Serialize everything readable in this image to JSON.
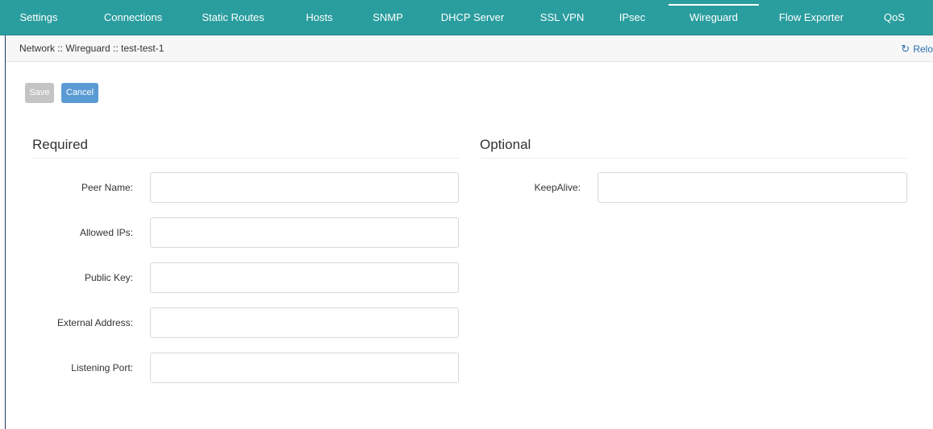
{
  "tabs": [
    {
      "label": "Settings"
    },
    {
      "label": "Connections"
    },
    {
      "label": "Static Routes"
    },
    {
      "label": "Hosts"
    },
    {
      "label": "SNMP"
    },
    {
      "label": "DHCP Server"
    },
    {
      "label": "SSL VPN"
    },
    {
      "label": "IPsec"
    },
    {
      "label": "Wireguard",
      "active": true
    },
    {
      "label": "Flow Exporter"
    },
    {
      "label": "QoS"
    }
  ],
  "breadcrumb": "Network :: Wireguard :: test-test-1",
  "reload_label": "Relo",
  "reload_icon": "refresh-icon",
  "buttons": {
    "save": "Save",
    "cancel": "Cancel"
  },
  "required": {
    "title": "Required",
    "fields": [
      {
        "label": "Peer Name:",
        "value": ""
      },
      {
        "label": "Allowed IPs:",
        "value": ""
      },
      {
        "label": "Public Key:",
        "value": ""
      },
      {
        "label": "External Address:",
        "value": ""
      },
      {
        "label": "Listening Port:",
        "value": ""
      }
    ]
  },
  "optional": {
    "title": "Optional",
    "fields": [
      {
        "label": "KeepAlive:",
        "value": ""
      }
    ]
  },
  "colors": {
    "tabbar": "#2a9d9f",
    "save_disabled": "#c4c4c4",
    "cancel": "#5b9bd5",
    "link": "#2a6fb0"
  }
}
